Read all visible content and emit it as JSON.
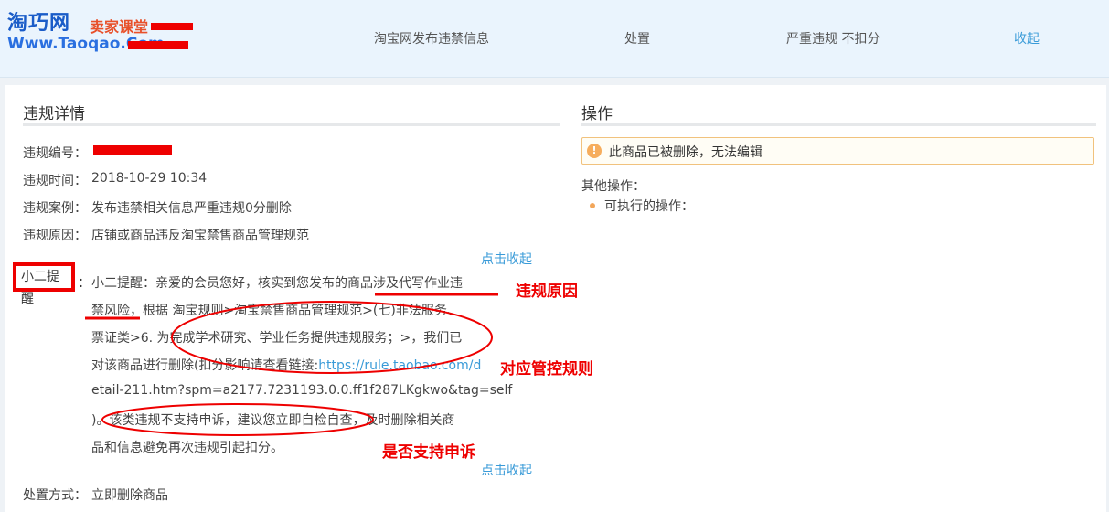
{
  "watermark": {
    "cn": "淘巧网",
    "red": "卖家课堂",
    "www": "Www.Taoqao.Com"
  },
  "header": {
    "info": "淘宝网发布违禁信息",
    "handle": "处置",
    "severity": "严重违规 不扣分",
    "toggle": "收起"
  },
  "details": {
    "title": "违规详情",
    "id_label": "违规编号：",
    "time_label": "违规时间：",
    "time_value": "2018-10-29 10:34",
    "case_label": "违规案例：",
    "case_value": "发布违禁相关信息严重违规0分删除",
    "reason_label": "违规原因：",
    "reason_value": "店铺或商品违反淘宝禁售商品管理规范",
    "toggle_top": "点击收起",
    "remind_label": "小二提醒",
    "remind_colon": "：",
    "remind_lines": [
      "小二提醒：亲爱的会员您好，核实到您发布的商品涉及代写作业违",
      "禁风险，根据 淘宝规则>淘宝禁售商品管理规范>(七)非法服务、",
      "票证类>6. 为完成学术研究、学业任务提供违规服务；>，我们已"
    ],
    "remind_line4_text": "对该商品进行删除(扣分影响请查看链接:",
    "remind_link_part1": "https://rule.taobao.com/d",
    "remind_link_part2": "etail-211.htm?spm=a2177.7231193.0.0.ff1f287LKgkwo&tag=self",
    "remind_lines_after": [
      ")。该类违规不支持申诉，建议您立即自检自查，及时删除相关商",
      "品和信息避免再次违规引起扣分。"
    ],
    "toggle_bottom": "点击收起",
    "handle_label": "处置方式：",
    "handle_value": "立即删除商品"
  },
  "operations": {
    "title": "操作",
    "notice_icon": "!",
    "notice": "此商品已被删除，无法编辑",
    "other_label": "其他操作：",
    "executable": "可执行的操作："
  },
  "annotations": {
    "reason": "违规原因",
    "rule": "对应管控规则",
    "appeal": "是否支持申诉"
  },
  "colors": {
    "accent": "#3a9bd8",
    "annotation": "#e00000",
    "notice_border": "#f1c27d"
  }
}
